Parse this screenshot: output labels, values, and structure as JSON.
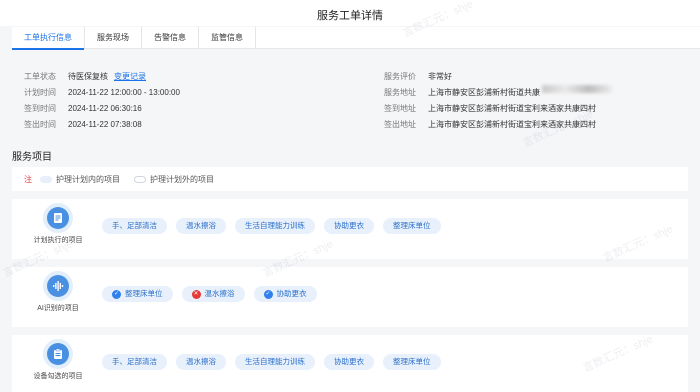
{
  "header": {
    "title": "服务工单详情"
  },
  "tabs": [
    {
      "label": "工单执行信息",
      "active": true
    },
    {
      "label": "服务现场"
    },
    {
      "label": "告警信息"
    },
    {
      "label": "监管信息"
    }
  ],
  "info": {
    "left": [
      {
        "label": "工单状态",
        "value": "待医保复核",
        "link": "变更记录"
      },
      {
        "label": "计划时间",
        "value": "2024-11-22 12:00:00 - 13:00:00"
      },
      {
        "label": "签到时间",
        "value": "2024-11-22 06:30:16"
      },
      {
        "label": "签出时间",
        "value": "2024-11-22 07:38:08"
      }
    ],
    "right": [
      {
        "label": "服务评价",
        "value": "非常好"
      },
      {
        "label": "服务地址",
        "value": "上海市静安区彭浦新村街道共康"
      },
      {
        "label": "签到地址",
        "value": "上海市静安区彭浦新村街道宝利来酒家共康四村"
      },
      {
        "label": "签出地址",
        "value": "上海市静安区彭浦新村街道宝利来酒家共康四村"
      }
    ]
  },
  "section": {
    "title": "服务项目"
  },
  "legend": {
    "note": "注",
    "in_plan": "护理计划内的项目",
    "out_plan": "护理计划外的项目"
  },
  "cards": [
    {
      "label": "计划执行的项目",
      "icon": "document-icon",
      "items": [
        {
          "label": "手、足部清洁"
        },
        {
          "label": "温水擦浴"
        },
        {
          "label": "生活自理能力训练"
        },
        {
          "label": "协助更衣"
        },
        {
          "label": "整理床单位"
        }
      ]
    },
    {
      "label": "AI识别的项目",
      "icon": "waveform-icon",
      "items": [
        {
          "label": "整理床单位",
          "status": "ok"
        },
        {
          "label": "温水擦浴",
          "status": "no"
        },
        {
          "label": "协助更衣",
          "status": "ok"
        }
      ]
    },
    {
      "label": "设备勾选的项目",
      "icon": "clipboard-icon",
      "items": [
        {
          "label": "手、足部清洁"
        },
        {
          "label": "温水擦浴"
        },
        {
          "label": "生活自理能力训练"
        },
        {
          "label": "协助更衣"
        },
        {
          "label": "整理床单位"
        }
      ]
    }
  ],
  "watermark": "言数汇元：shje",
  "colors": {
    "accent": "#1a73e8",
    "pill_bg": "#e8f0fb",
    "pill_text": "#2a6fc9",
    "error": "#e53935",
    "icon_circle": "#4a90e2"
  }
}
